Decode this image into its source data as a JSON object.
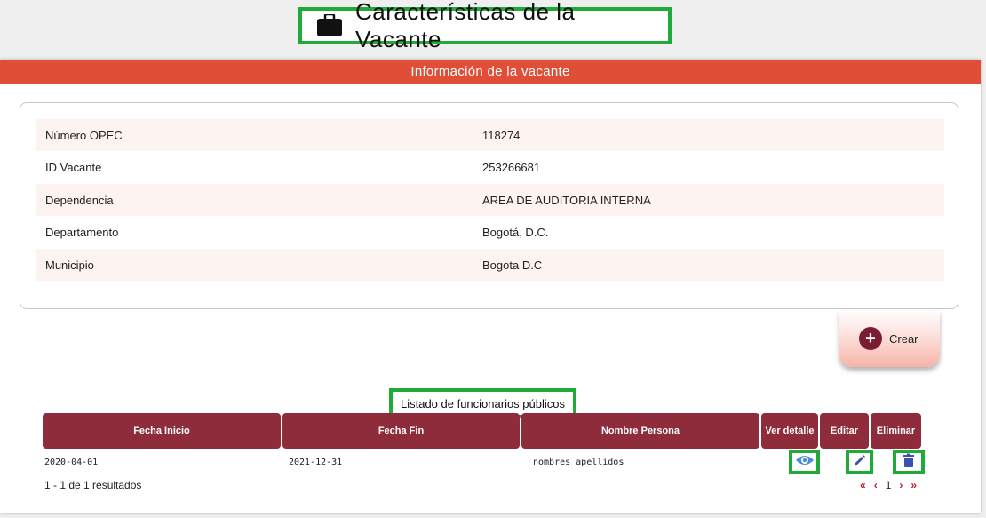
{
  "header": {
    "title": "Características de la Vacante"
  },
  "card": {
    "header_title": "Información de la vacante",
    "rows": [
      {
        "label": "Número OPEC",
        "value": "118274"
      },
      {
        "label": "ID Vacante",
        "value": "253266681"
      },
      {
        "label": "Dependencia",
        "value": "AREA DE AUDITORIA INTERNA"
      },
      {
        "label": "Departamento",
        "value": "Bogotá, D.C."
      },
      {
        "label": "Municipio",
        "value": "Bogota D.C"
      }
    ]
  },
  "actions": {
    "create_label": "Crear"
  },
  "list": {
    "title": "Listado de funcionarios públicos",
    "columns": [
      "Fecha Inicio",
      "Fecha Fin",
      "Nombre Persona",
      "Ver detalle",
      "Editar",
      "Eliminar"
    ],
    "rows": [
      {
        "fecha_inicio": "2020-04-01",
        "fecha_fin": "2021-12-31",
        "nombre": "nombres apellidos"
      }
    ],
    "results_text": "1 - 1 de 1 resultados"
  },
  "pagination": {
    "first": "«",
    "prev": "‹",
    "current": "1",
    "next": "›",
    "last": "»"
  },
  "colors": {
    "header_bar": "#e04e38",
    "table_header": "#8e2c3c",
    "highlight_border": "#1faa3a",
    "view_icon": "#4a8fd1",
    "edit_icon": "#3a4fb0",
    "delete_icon": "#3a4fb0"
  }
}
